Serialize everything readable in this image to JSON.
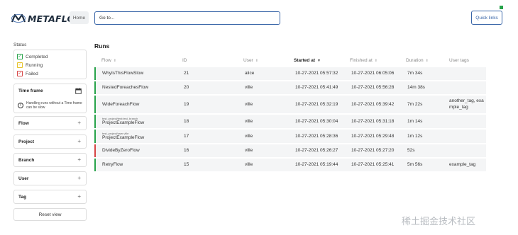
{
  "header": {
    "logo_text": "METAFLOW",
    "home_label": "Home",
    "search_placeholder": "Go to...",
    "quick_links_label": "Quick links",
    "connection_color": "#27a34a"
  },
  "sidebar": {
    "status_title": "Status",
    "status_items": [
      {
        "label": "Completed",
        "color": "#27a34a"
      },
      {
        "label": "Running",
        "color": "#e6c229"
      },
      {
        "label": "Failed",
        "color": "#d64545"
      }
    ],
    "timeframe_title": "Time frame",
    "timeframe_note": "Handling runs without a Time frame can be slow",
    "filters": [
      "Flow",
      "Project",
      "Branch",
      "User",
      "Tag"
    ],
    "reset_label": "Reset view"
  },
  "main": {
    "title": "Runs",
    "columns": [
      "Flow",
      "ID",
      "User",
      "Started at",
      "Finished at",
      "Duration",
      "User tags"
    ],
    "active_sort_column": "Started at",
    "rows": [
      {
        "status": "completed",
        "project": "",
        "flow": "WhyIsThisFlowSlow",
        "id": "21",
        "user": "alice",
        "started": "10-27-2021 05:57:32",
        "finished": "10-27-2021 06:05:06",
        "duration": "7m 34s",
        "tags": ""
      },
      {
        "status": "completed",
        "project": "",
        "flow": "NestedForeachesFlow",
        "id": "20",
        "user": "ville",
        "started": "10-27-2021 05:41:49",
        "finished": "10-27-2021 05:56:28",
        "duration": "14m 38s",
        "tags": ""
      },
      {
        "status": "completed",
        "project": "",
        "flow": "WideForeachFlow",
        "id": "19",
        "user": "ville",
        "started": "10-27-2021 05:32:19",
        "finished": "10-27-2021 05:39:42",
        "duration": "7m 22s",
        "tags": "another_tag, example_tag"
      },
      {
        "status": "completed",
        "project": "test_project/test:test_branch",
        "flow": "ProjectExampleFlow",
        "id": "18",
        "user": "ville",
        "started": "10-27-2021 05:30:04",
        "finished": "10-27-2021 05:31:18",
        "duration": "1m 14s",
        "tags": ""
      },
      {
        "status": "completed",
        "project": "test_project/user.ville",
        "flow": "ProjectExampleFlow",
        "id": "17",
        "user": "ville",
        "started": "10-27-2021 05:28:36",
        "finished": "10-27-2021 05:29:48",
        "duration": "1m 12s",
        "tags": ""
      },
      {
        "status": "failed",
        "project": "",
        "flow": "DivideByZeroFlow",
        "id": "16",
        "user": "ville",
        "started": "10-27-2021 05:26:27",
        "finished": "10-27-2021 05:27:20",
        "duration": "52s",
        "tags": ""
      },
      {
        "status": "completed",
        "project": "",
        "flow": "RetryFlow",
        "id": "15",
        "user": "ville",
        "started": "10-27-2021 05:19:44",
        "finished": "10-27-2021 05:25:41",
        "duration": "5m 56s",
        "tags": "example_tag"
      }
    ]
  },
  "watermark": "稀土掘金技术社区"
}
